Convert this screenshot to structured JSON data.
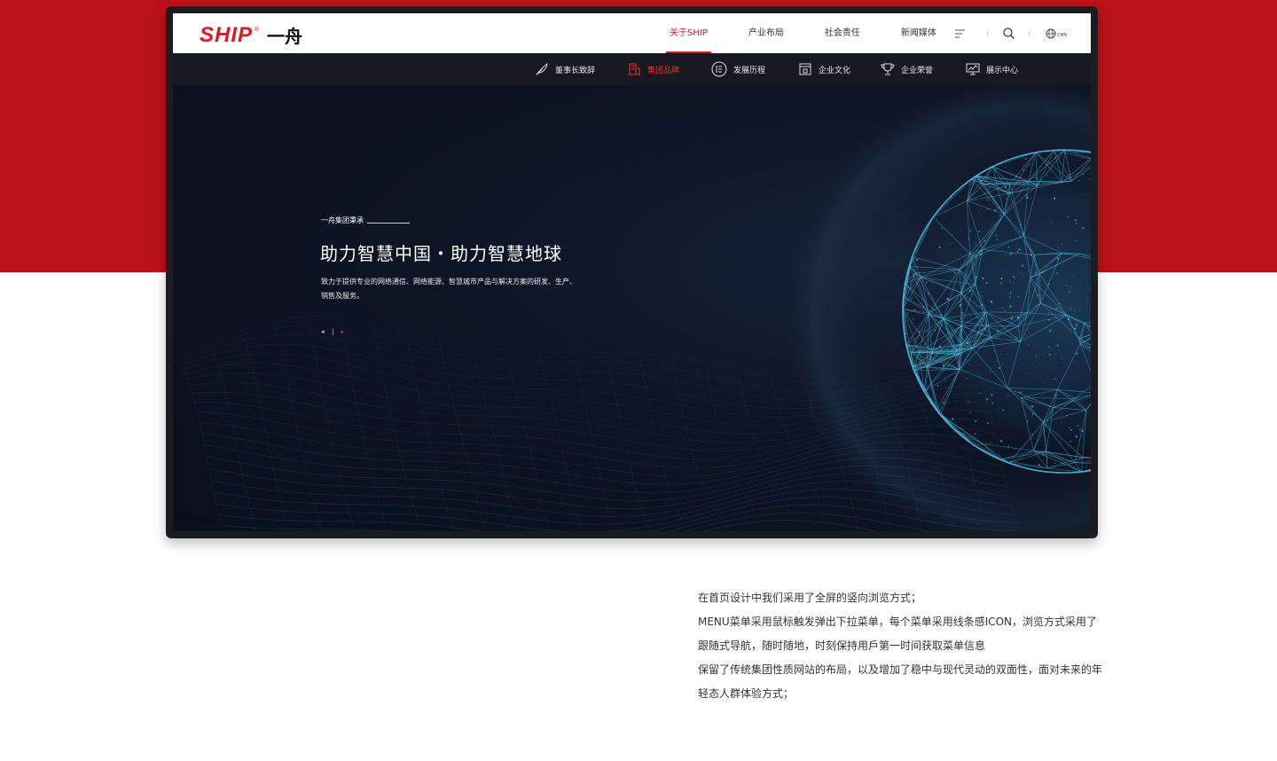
{
  "brand": {
    "logo_latin": "SHIP",
    "logo_reg": "®",
    "logo_cn": "一舟"
  },
  "nav": {
    "items": [
      {
        "label": "关于SHIP",
        "active": true
      },
      {
        "label": "产业布局",
        "active": false
      },
      {
        "label": "社会责任",
        "active": false
      },
      {
        "label": "新闻媒体",
        "active": false
      }
    ],
    "lang_label": "CHN"
  },
  "subnav": {
    "items": [
      {
        "label": "董事长致辞",
        "icon": "feather-icon",
        "active": false
      },
      {
        "label": "集团品牌",
        "icon": "building-icon",
        "active": true
      },
      {
        "label": "发展历程",
        "icon": "timeline-icon",
        "active": false
      },
      {
        "label": "企业文化",
        "icon": "culture-book-icon",
        "active": false
      },
      {
        "label": "企业荣誉",
        "icon": "trophy-icon",
        "active": false
      },
      {
        "label": "展示中心",
        "icon": "display-screen-icon",
        "active": false
      }
    ]
  },
  "hero": {
    "eyebrow": "一舟集团秉承",
    "title": "助力智慧中国・助力智慧地球",
    "description": "致力于提供专业的网络通信、网络能源、智慧城市产品与解决方案的研发、生产、销售及服务。",
    "prev_symbol": "◂",
    "next_symbol": "▸"
  },
  "description_lines": [
    "在首页设计中我们采用了全屏的竖向浏览方式；",
    "MENU菜单采用鼠标触发弹出下拉菜单，每个菜单采用线条感ICON，浏览方式采用了",
    "跟随式导航，随时随地，时刻保持用戶第一时间获取菜单信息",
    "保留了传统集团性质网站的布局，以及增加了稳中与现代灵动的双面性，面对未来的年",
    "轻态人群体验方式；"
  ],
  "colors": {
    "brand_red": "#ba1219",
    "accent_red": "#d61b21",
    "dark_bg": "#0c1220",
    "subnav_bg": "#17191f",
    "globe_cyan": "#4cc3e6"
  }
}
